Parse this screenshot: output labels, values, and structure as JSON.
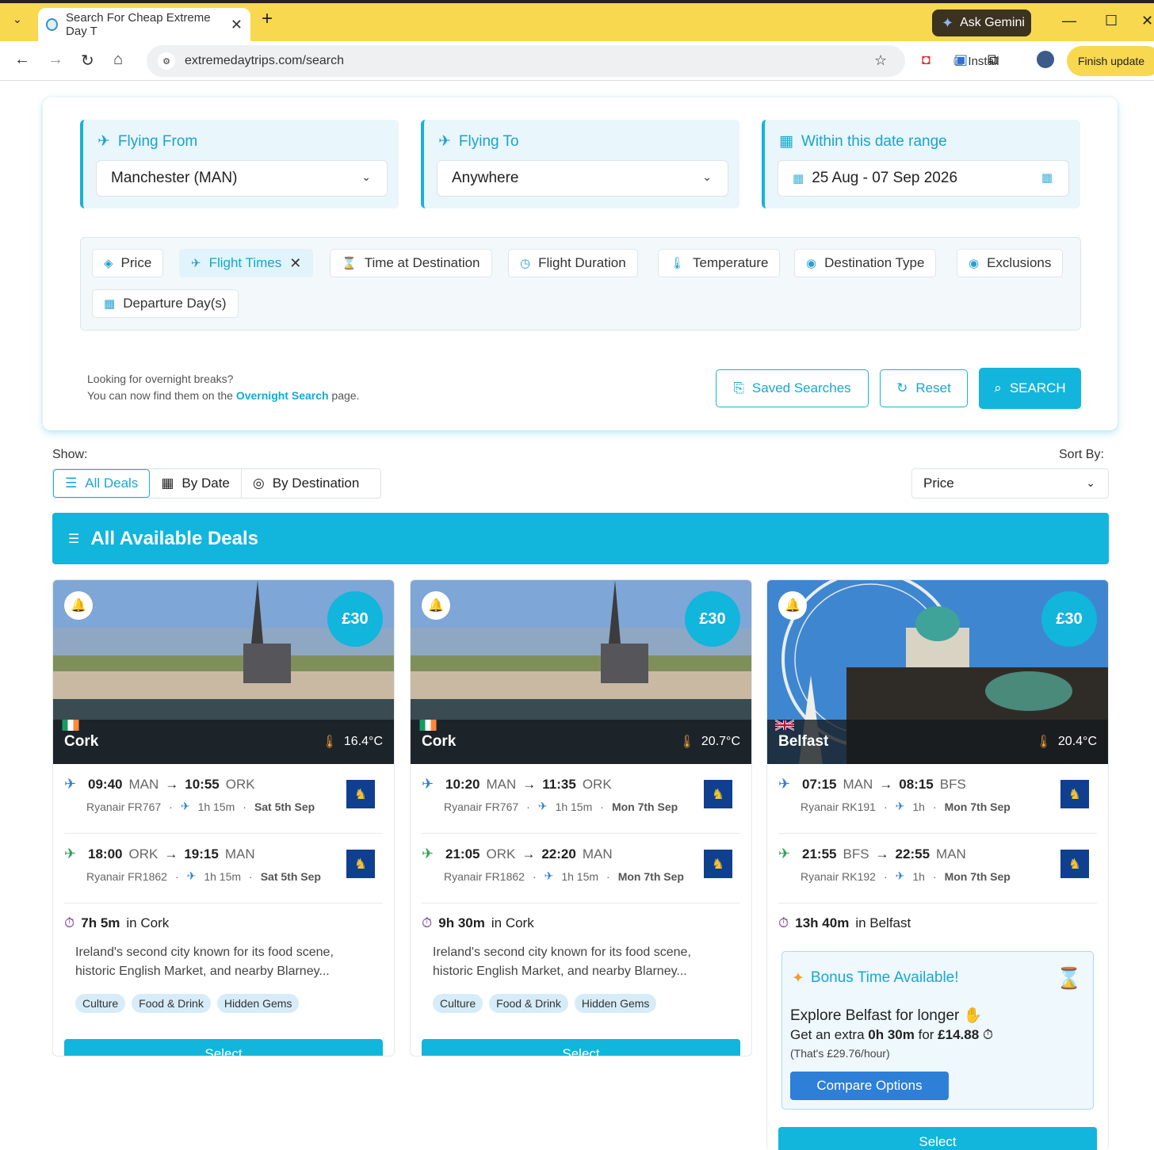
{
  "browser": {
    "tab_title": "Search For Cheap Extreme Day T",
    "url": "extremedaytrips.com/search",
    "install_label": "Install",
    "gemini_label": "Ask Gemini",
    "finish_update_label": "Finish update"
  },
  "search": {
    "from": {
      "label": "Flying From",
      "value": "Manchester (MAN)"
    },
    "to": {
      "label": "Flying To",
      "value": "Anywhere"
    },
    "dates": {
      "label": "Within this date range",
      "value": "25 Aug - 07 Sep 2026"
    },
    "filters": [
      "Price",
      "Flight Times",
      "Time at Destination",
      "Flight Duration",
      "Temperature",
      "Destination Type",
      "Exclusions",
      "Departure Day(s)"
    ],
    "overnight_line1": "Looking for overnight breaks?",
    "overnight_line2_pre": "You can now find them on the ",
    "overnight_link": "Overnight Search",
    "overnight_line2_post": " page.",
    "saved_searches_label": "Saved Searches",
    "reset_label": "Reset",
    "search_label": "SEARCH"
  },
  "results": {
    "show_label": "Show:",
    "sort_label": "Sort By:",
    "views": [
      "All Deals",
      "By Date",
      "By Destination"
    ],
    "sort_value": "Price",
    "banner_title": "All Available Deals"
  },
  "cards": [
    {
      "city": "Cork",
      "temp": "16.4°C",
      "price": "£30",
      "out": {
        "dep": "09:40",
        "dep_ap": "MAN",
        "arr": "10:55",
        "arr_ap": "ORK",
        "flight": "Ryanair FR767",
        "dur": "1h 15m",
        "date": "Sat 5th Sep"
      },
      "ret": {
        "dep": "18:00",
        "dep_ap": "ORK",
        "arr": "19:15",
        "arr_ap": "MAN",
        "flight": "Ryanair FR1862",
        "dur": "1h 15m",
        "date": "Sat 5th Sep"
      },
      "stay": "7h 5m",
      "stay_in": "in Cork",
      "desc": "Ireland's second city known for its food scene, historic English Market, and nearby Blarney...",
      "tags": [
        "Culture",
        "Food & Drink",
        "Hidden Gems"
      ],
      "select": "Select"
    },
    {
      "city": "Cork",
      "temp": "20.7°C",
      "price": "£30",
      "out": {
        "dep": "10:20",
        "dep_ap": "MAN",
        "arr": "11:35",
        "arr_ap": "ORK",
        "flight": "Ryanair FR767",
        "dur": "1h 15m",
        "date": "Mon 7th Sep"
      },
      "ret": {
        "dep": "21:05",
        "dep_ap": "ORK",
        "arr": "22:20",
        "arr_ap": "MAN",
        "flight": "Ryanair FR1862",
        "dur": "1h 15m",
        "date": "Mon 7th Sep"
      },
      "stay": "9h 30m",
      "stay_in": "in Cork",
      "desc": "Ireland's second city known for its food scene, historic English Market, and nearby Blarney...",
      "tags": [
        "Culture",
        "Food & Drink",
        "Hidden Gems"
      ],
      "select": "Select"
    },
    {
      "city": "Belfast",
      "temp": "20.4°C",
      "price": "£30",
      "out": {
        "dep": "07:15",
        "dep_ap": "MAN",
        "arr": "08:15",
        "arr_ap": "BFS",
        "flight": "Ryanair RK191",
        "dur": "1h",
        "date": "Mon 7th Sep"
      },
      "ret": {
        "dep": "21:55",
        "dep_ap": "BFS",
        "arr": "22:55",
        "arr_ap": "MAN",
        "flight": "Ryanair RK192",
        "dur": "1h",
        "date": "Mon 7th Sep"
      },
      "stay": "13h 40m",
      "stay_in": "in Belfast",
      "bonus": {
        "title": "Bonus Time Available!",
        "line1": "Explore Belfast for longer",
        "line2_pre": "Get an extra ",
        "extra": "0h 30m",
        "line2_mid": " for ",
        "cost": "£14.88",
        "line3": "(That's £29.76/hour)",
        "compare": "Compare Options"
      },
      "select": "Select"
    }
  ],
  "colors": {
    "accent": "#12b5dc",
    "chrome": "#f7d84f",
    "ryanair": "#0f3f8f"
  }
}
